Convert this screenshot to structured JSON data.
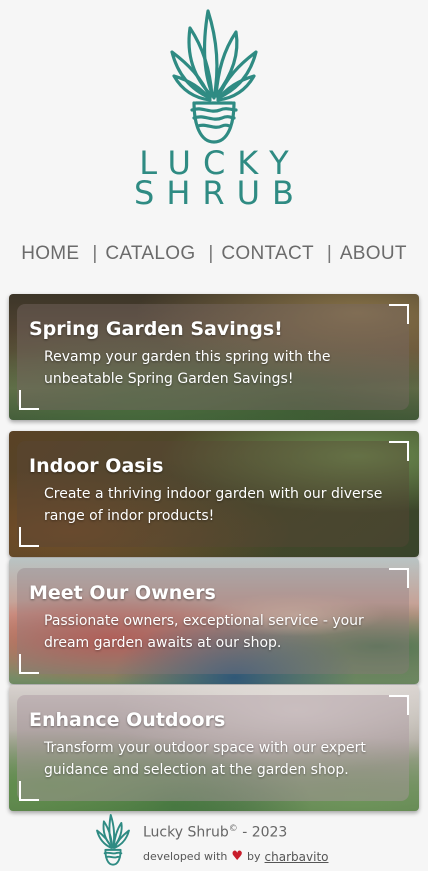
{
  "brand": {
    "line1": "LUCKY",
    "line2": "SHRUB",
    "color": "#2f8b83",
    "icon": "plant-logo-icon"
  },
  "nav": {
    "items": [
      "HOME",
      "CATALOG",
      "CONTACT",
      "ABOUT"
    ],
    "separator": "|"
  },
  "cards": [
    {
      "title": "Spring Garden Savings!",
      "text": "Revamp your garden this spring with the unbeatable Spring Garden Savings!"
    },
    {
      "title": "Indoor Oasis",
      "text": "Create a thriving indoor garden with our diverse range of indor products!"
    },
    {
      "title": "Meet Our Owners",
      "text": "Passionate owners, exceptional service - your dream garden awaits at our shop."
    },
    {
      "title": "Enhance Outdoors",
      "text": "Transform your outdoor space with our expert guidance and selection at the garden shop."
    }
  ],
  "footer": {
    "name": "Lucky Shrub",
    "copyright": "©",
    "year_text": " - 2023",
    "developed_with": "developed with",
    "heart": "♥",
    "by": "by",
    "author": "charbavito",
    "heart_color": "#c81d2b"
  }
}
